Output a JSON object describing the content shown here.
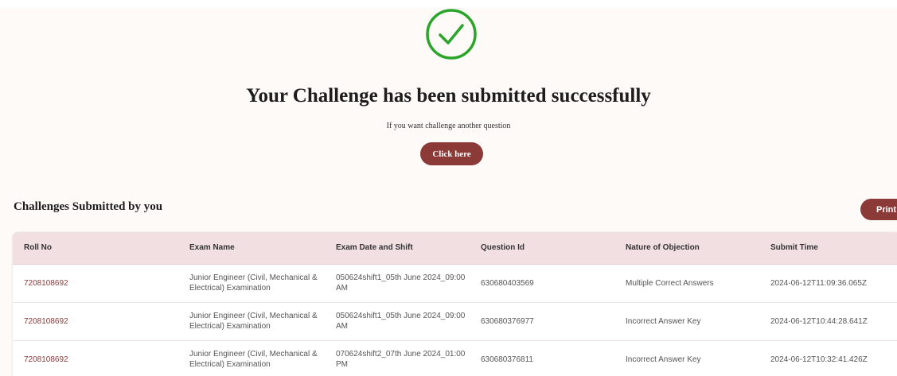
{
  "success": {
    "headline": "Your Challenge has been submitted successfully",
    "subtext": "If you want challenge another question",
    "button_label": "Click here",
    "icon": "check-circle-icon",
    "icon_color": "#2aa52a"
  },
  "challenges": {
    "title": "Challenges Submitted by you",
    "print_label": "Print",
    "columns": [
      "Roll No",
      "Exam Name",
      "Exam Date and Shift",
      "Question Id",
      "Nature of Objection",
      "Submit Time"
    ],
    "rows": [
      {
        "roll_no": "7208108692",
        "exam_name": "Junior Engineer (Civil, Mechanical & Electrical) Examination",
        "exam_date_shift": "050624shift1_05th June 2024_09:00 AM",
        "question_id": "630680403569",
        "objection": "Multiple Correct Answers",
        "submit_time": "2024-06-12T11:09:36.065Z"
      },
      {
        "roll_no": "7208108692",
        "exam_name": "Junior Engineer (Civil, Mechanical & Electrical) Examination",
        "exam_date_shift": "050624shift1_05th June 2024_09:00 AM",
        "question_id": "630680376977",
        "objection": "Incorrect Answer Key",
        "submit_time": "2024-06-12T10:44:28.641Z"
      },
      {
        "roll_no": "7208108692",
        "exam_name": "Junior Engineer (Civil, Mechanical & Electrical) Examination",
        "exam_date_shift": "070624shift2_07th June 2024_01:00 PM",
        "question_id": "630680376811",
        "objection": "Incorrect Answer Key",
        "submit_time": "2024-06-12T10:32:41.426Z"
      }
    ]
  },
  "colors": {
    "accent": "#8c3a38",
    "header_bg": "#f2dfe2",
    "page_bg": "#fdfaf8"
  }
}
